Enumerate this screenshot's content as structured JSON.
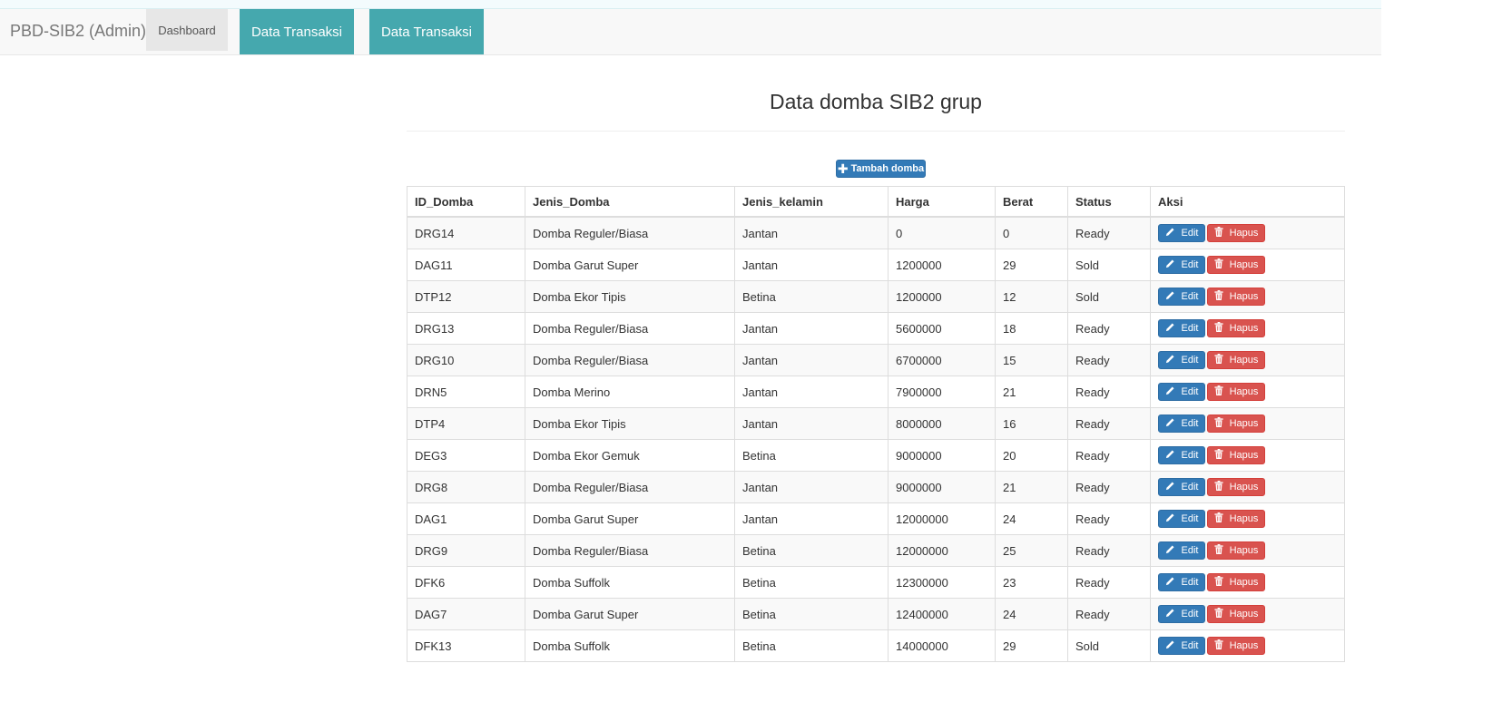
{
  "nav": {
    "brand": "PBD-SIB2 (Admin)",
    "dashboard": "Dashboard",
    "menu1": "Data Transaksi",
    "menu2": "Data Transaksi"
  },
  "main": {
    "title": "Data domba SIB2 grup",
    "add_button": "Tambah domba"
  },
  "table": {
    "headers": [
      "ID_Domba",
      "Jenis_Domba",
      "Jenis_kelamin",
      "Harga",
      "Berat",
      "Status",
      "Aksi"
    ],
    "edit_label": "Edit",
    "delete_label": "Hapus",
    "rows": [
      {
        "id": "DRG14",
        "jenis": "Domba Reguler/Biasa",
        "kelamin": "Jantan",
        "harga": "0",
        "berat": "0",
        "status": "Ready"
      },
      {
        "id": "DAG11",
        "jenis": "Domba Garut Super",
        "kelamin": "Jantan",
        "harga": "1200000",
        "berat": "29",
        "status": "Sold"
      },
      {
        "id": "DTP12",
        "jenis": "Domba Ekor Tipis",
        "kelamin": "Betina",
        "harga": "1200000",
        "berat": "12",
        "status": "Sold"
      },
      {
        "id": "DRG13",
        "jenis": "Domba Reguler/Biasa",
        "kelamin": "Jantan",
        "harga": "5600000",
        "berat": "18",
        "status": "Ready"
      },
      {
        "id": "DRG10",
        "jenis": "Domba Reguler/Biasa",
        "kelamin": "Jantan",
        "harga": "6700000",
        "berat": "15",
        "status": "Ready"
      },
      {
        "id": "DRN5",
        "jenis": "Domba Merino",
        "kelamin": "Jantan",
        "harga": "7900000",
        "berat": "21",
        "status": "Ready"
      },
      {
        "id": "DTP4",
        "jenis": "Domba Ekor Tipis",
        "kelamin": "Jantan",
        "harga": "8000000",
        "berat": "16",
        "status": "Ready"
      },
      {
        "id": "DEG3",
        "jenis": "Domba Ekor Gemuk",
        "kelamin": "Betina",
        "harga": "9000000",
        "berat": "20",
        "status": "Ready"
      },
      {
        "id": "DRG8",
        "jenis": "Domba Reguler/Biasa",
        "kelamin": "Jantan",
        "harga": "9000000",
        "berat": "21",
        "status": "Ready"
      },
      {
        "id": "DAG1",
        "jenis": "Domba Garut Super",
        "kelamin": "Jantan",
        "harga": "12000000",
        "berat": "24",
        "status": "Ready"
      },
      {
        "id": "DRG9",
        "jenis": "Domba Reguler/Biasa",
        "kelamin": "Betina",
        "harga": "12000000",
        "berat": "25",
        "status": "Ready"
      },
      {
        "id": "DFK6",
        "jenis": "Domba Suffolk",
        "kelamin": "Betina",
        "harga": "12300000",
        "berat": "23",
        "status": "Ready"
      },
      {
        "id": "DAG7",
        "jenis": "Domba Garut Super",
        "kelamin": "Betina",
        "harga": "12400000",
        "berat": "24",
        "status": "Ready"
      },
      {
        "id": "DFK13",
        "jenis": "Domba Suffolk",
        "kelamin": "Betina",
        "harga": "14000000",
        "berat": "29",
        "status": "Sold"
      }
    ]
  },
  "icons": {
    "add": "plus-icon",
    "edit": "pencil-icon",
    "delete": "trash-icon"
  },
  "colors": {
    "teal_nav": "#45a8ae",
    "primary": "#337ab7",
    "danger": "#d9534f"
  }
}
